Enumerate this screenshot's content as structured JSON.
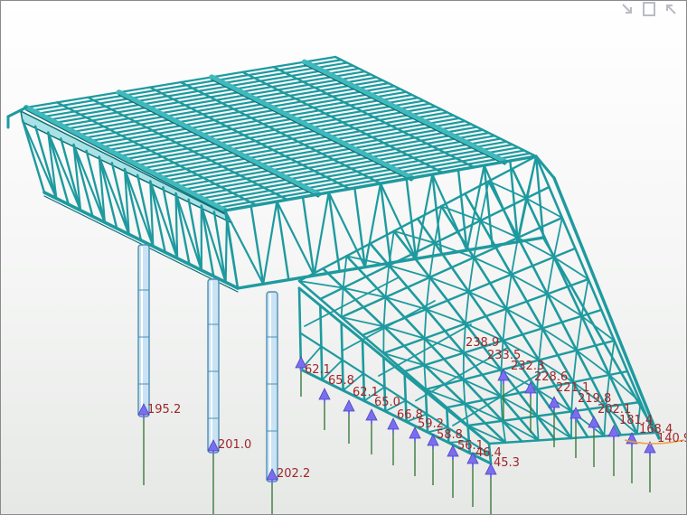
{
  "viewport": {
    "background": "#ffffff",
    "member_color": "#1e9a9f",
    "member_dark": "#0f6f74",
    "column_color": "#c9e3f4",
    "load_arrow_color": "#7a6ef0",
    "support_line_color": "#3b7a3b",
    "label_color": "#a0262a"
  },
  "toolbar": {
    "icons": [
      "collapse-arrow-icon",
      "restore-window-icon",
      "expand-arrow-icon"
    ]
  },
  "reactions": {
    "left_columns": [
      "195.2",
      "201.0",
      "202.2"
    ],
    "front_row": [
      "62.1",
      "65.8",
      "62.1",
      "65.0",
      "66.8",
      "59.2",
      "58.8",
      "56.1",
      "46.4",
      "45.3"
    ],
    "slope_row": [
      "238.9",
      "233.5",
      "232.3",
      "228.6",
      "221.1",
      "219.8",
      "202.1",
      "181.4",
      "168.4",
      "140.9"
    ]
  }
}
